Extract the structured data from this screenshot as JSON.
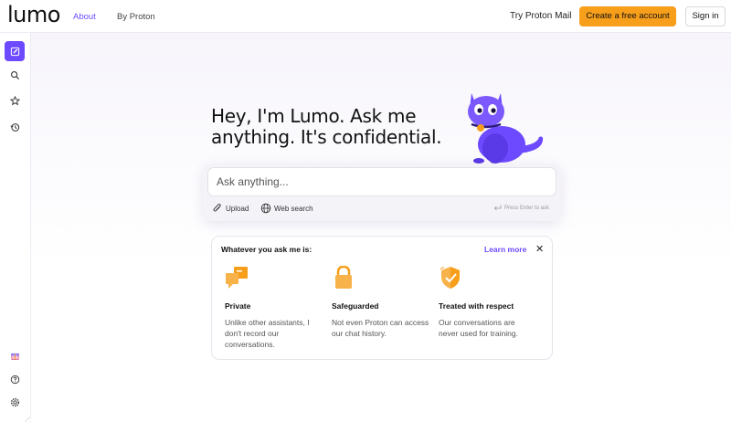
{
  "header": {
    "logo": "lumo",
    "nav": [
      {
        "label": "About",
        "active": true
      },
      {
        "label": "By Proton",
        "active": false
      }
    ],
    "try_mail": "Try Proton Mail",
    "create_account": "Create a free account",
    "sign_in": "Sign in"
  },
  "sidebar": {
    "items": [
      "new-chat-icon",
      "search-icon",
      "star-icon",
      "history-icon"
    ],
    "bottom": [
      "gift-icon",
      "help-icon",
      "settings-icon"
    ]
  },
  "hero": {
    "title_line1": "Hey, I'm Lumo. Ask me",
    "title_line2": "anything. It's confidential."
  },
  "ask": {
    "placeholder": "Ask anything...",
    "upload": "Upload",
    "web_search": "Web search",
    "press_enter": "Press Enter to ask"
  },
  "card": {
    "title": "Whatever you ask me is:",
    "learn_more": "Learn more",
    "features": [
      {
        "title": "Private",
        "desc_lines": [
          "Unlike other assistants, I",
          "don't record our",
          "conversations."
        ]
      },
      {
        "title": "Safeguarded",
        "desc_lines": [
          "Not even Proton can access",
          "our chat history."
        ]
      },
      {
        "title": "Treated with respect",
        "desc_lines": [
          "Our conversations are",
          "never used for training."
        ]
      }
    ]
  },
  "colors": {
    "brand": "#6d4aff",
    "accent": "#f79e1b"
  }
}
